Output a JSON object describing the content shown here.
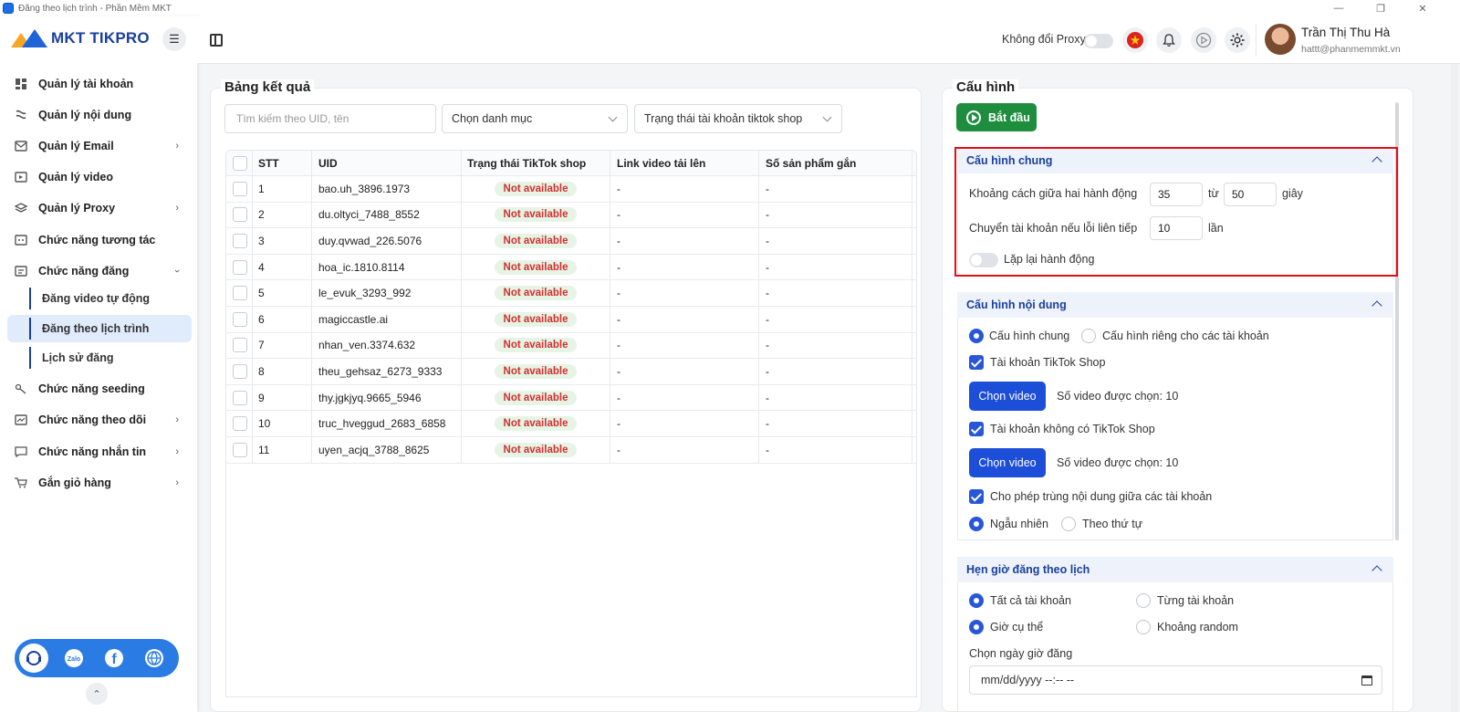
{
  "window": {
    "title": "Đăng theo lịch trình - Phần Mềm MKT"
  },
  "sidebar": {
    "logo_text": "MKT TIKPRO",
    "items": [
      {
        "label": "Quản lý tài khoản",
        "icon": "dashboard-icon"
      },
      {
        "label": "Quản lý nội dung",
        "icon": "content-icon"
      },
      {
        "label": "Quản lý Email",
        "icon": "email-icon",
        "has_submenu": true
      },
      {
        "label": "Quản lý video",
        "icon": "video-icon"
      },
      {
        "label": "Quản lý Proxy",
        "icon": "proxy-icon",
        "has_submenu": true
      },
      {
        "label": "Chức năng tương tác",
        "icon": "interaction-icon"
      },
      {
        "label": "Chức năng đăng",
        "icon": "post-icon",
        "expanded": true
      }
    ],
    "sub_items": [
      {
        "label": "Đăng video tự động"
      },
      {
        "label": "Đăng theo lịch trình",
        "active": true
      },
      {
        "label": "Lịch sử đăng"
      }
    ],
    "items_after": [
      {
        "label": "Chức năng seeding",
        "icon": "seeding-icon"
      },
      {
        "label": "Chức năng theo dõi",
        "icon": "follow-icon",
        "has_submenu": true
      },
      {
        "label": "Chức năng nhắn tin",
        "icon": "message-icon",
        "has_submenu": true
      },
      {
        "label": "Gắn giỏ hàng",
        "icon": "cart-icon",
        "has_submenu": true
      }
    ],
    "social": [
      "support-icon",
      "zalo-icon",
      "facebook-icon",
      "website-icon"
    ]
  },
  "header": {
    "proxy_label": "Không đổi Proxy",
    "proxy_toggle_on": false,
    "user_name": "Trần Thị Thu Hà",
    "user_email": "hattt@phanmemmkt.vn"
  },
  "results": {
    "title": "Bảng kết quả",
    "search_placeholder": "Tìm kiếm theo UID, tên",
    "category_select": "Chọn danh mục",
    "status_select": "Trạng thái tài khoản tiktok shop",
    "columns": [
      "STT",
      "UID",
      "Trạng thái TikTok shop",
      "Link video tải lên",
      "Số sản phẩm gắn"
    ],
    "rows": [
      {
        "stt": "1",
        "uid": "bao.uh_3896.1973",
        "status": "Not available",
        "link": "-",
        "products": "-"
      },
      {
        "stt": "2",
        "uid": "du.oltyci_7488_8552",
        "status": "Not available",
        "link": "-",
        "products": "-"
      },
      {
        "stt": "3",
        "uid": "duy.qvwad_226.5076",
        "status": "Not available",
        "link": "-",
        "products": "-"
      },
      {
        "stt": "4",
        "uid": "hoa_ic.1810.8114",
        "status": "Not available",
        "link": "-",
        "products": "-"
      },
      {
        "stt": "5",
        "uid": "le_evuk_3293_992",
        "status": "Not available",
        "link": "-",
        "products": "-"
      },
      {
        "stt": "6",
        "uid": "magiccastle.ai",
        "status": "Not available",
        "link": "-",
        "products": "-"
      },
      {
        "stt": "7",
        "uid": "nhan_ven.3374.632",
        "status": "Not available",
        "link": "-",
        "products": "-"
      },
      {
        "stt": "8",
        "uid": "theu_gehsaz_6273_9333",
        "status": "Not available",
        "link": "-",
        "products": "-"
      },
      {
        "stt": "9",
        "uid": "thy.jgkjyq.9665_5946",
        "status": "Not available",
        "link": "-",
        "products": "-"
      },
      {
        "stt": "10",
        "uid": "truc_hveggud_2683_6858",
        "status": "Not available",
        "link": "-",
        "products": "-"
      },
      {
        "stt": "11",
        "uid": "uyen_acjq_3788_8625",
        "status": "Not available",
        "link": "-",
        "products": "-"
      }
    ]
  },
  "config": {
    "title": "Cấu hình",
    "start_button": "Bắt đầu",
    "general": {
      "title": "Cấu hình chung",
      "delay_label": "Khoảng cách giữa hai hành động",
      "delay_from": "35",
      "to_label": "từ",
      "delay_to": "50",
      "seconds_label": "giây",
      "switch_label": "Chuyển tài khoản nếu lỗi liên tiếp",
      "switch_count": "10",
      "times_label": "lần",
      "repeat_label": "Lặp lại hành động",
      "repeat_on": false
    },
    "content": {
      "title": "Cấu hình nội dung",
      "mode_general": "Cấu hình chung",
      "mode_per_account": "Cấu hình riêng cho các tài khoản",
      "tiktok_shop_account": "Tài khoản TikTok Shop",
      "choose_video": "Chọn video",
      "selected_count_1": "Số video được chọn: 10",
      "non_shop_account": "Tài khoản không có TikTok Shop",
      "choose_video_2": "Chọn video",
      "selected_count_2": "Số video được chọn: 10",
      "allow_duplicate": "Cho phép trùng nội dung giữa các tài khoản",
      "random": "Ngẫu nhiên",
      "sequential": "Theo thứ tự"
    },
    "schedule": {
      "title": "Hẹn giờ đăng theo lịch",
      "all_accounts": "Tất cả tài khoản",
      "each_account": "Từng tài khoản",
      "specific_time": "Giờ cụ thể",
      "random_range": "Khoảng random",
      "date_label": "Chọn ngày giờ đăng",
      "date_placeholder": "mm/dd/yyyy --:-- --"
    }
  },
  "colors": {
    "primary": "#1d4ed8",
    "start_green": "#1e8e3e",
    "badge_text": "#d32f2f",
    "badge_bg": "#e6f4e6",
    "highlight": "#e0101a"
  }
}
